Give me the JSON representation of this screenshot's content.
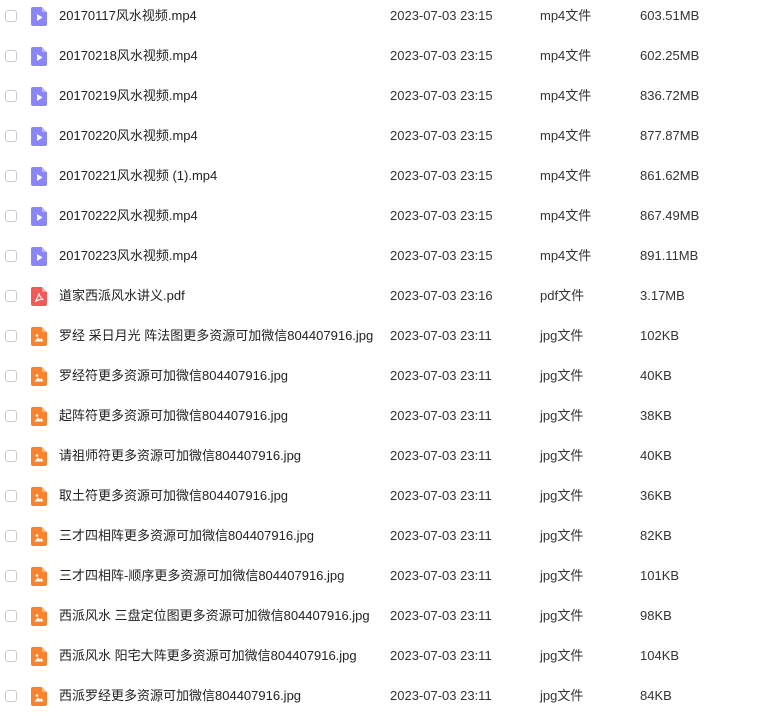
{
  "colors": {
    "video_icon": "#8b86f5",
    "pdf_icon": "#f25a5a",
    "image_icon": "#f7832f",
    "checkbox_border": "#c8c8c8",
    "text": "#222222"
  },
  "icons": {
    "video": "video-file-icon",
    "pdf": "pdf-file-icon",
    "image": "image-file-icon"
  },
  "files": [
    {
      "name": "20170117风水视频.mp4",
      "date": "2023-07-03 23:15",
      "type": "mp4文件",
      "size": "603.51MB",
      "kind": "video"
    },
    {
      "name": "20170218风水视频.mp4",
      "date": "2023-07-03 23:15",
      "type": "mp4文件",
      "size": "602.25MB",
      "kind": "video"
    },
    {
      "name": "20170219风水视频.mp4",
      "date": "2023-07-03 23:15",
      "type": "mp4文件",
      "size": "836.72MB",
      "kind": "video"
    },
    {
      "name": "20170220风水视频.mp4",
      "date": "2023-07-03 23:15",
      "type": "mp4文件",
      "size": "877.87MB",
      "kind": "video"
    },
    {
      "name": "20170221风水视频 (1).mp4",
      "date": "2023-07-03 23:15",
      "type": "mp4文件",
      "size": "861.62MB",
      "kind": "video"
    },
    {
      "name": "20170222风水视频.mp4",
      "date": "2023-07-03 23:15",
      "type": "mp4文件",
      "size": "867.49MB",
      "kind": "video"
    },
    {
      "name": "20170223风水视频.mp4",
      "date": "2023-07-03 23:15",
      "type": "mp4文件",
      "size": "891.11MB",
      "kind": "video"
    },
    {
      "name": "道家西派风水讲义.pdf",
      "date": "2023-07-03 23:16",
      "type": "pdf文件",
      "size": "3.17MB",
      "kind": "pdf"
    },
    {
      "name": "罗经 采日月光 阵法图更多资源可加微信804407916.jpg",
      "date": "2023-07-03 23:11",
      "type": "jpg文件",
      "size": "102KB",
      "kind": "image"
    },
    {
      "name": "罗经符更多资源可加微信804407916.jpg",
      "date": "2023-07-03 23:11",
      "type": "jpg文件",
      "size": "40KB",
      "kind": "image"
    },
    {
      "name": "起阵符更多资源可加微信804407916.jpg",
      "date": "2023-07-03 23:11",
      "type": "jpg文件",
      "size": "38KB",
      "kind": "image"
    },
    {
      "name": "请祖师符更多资源可加微信804407916.jpg",
      "date": "2023-07-03 23:11",
      "type": "jpg文件",
      "size": "40KB",
      "kind": "image"
    },
    {
      "name": "取土符更多资源可加微信804407916.jpg",
      "date": "2023-07-03 23:11",
      "type": "jpg文件",
      "size": "36KB",
      "kind": "image"
    },
    {
      "name": "三才四相阵更多资源可加微信804407916.jpg",
      "date": "2023-07-03 23:11",
      "type": "jpg文件",
      "size": "82KB",
      "kind": "image"
    },
    {
      "name": "三才四相阵-顺序更多资源可加微信804407916.jpg",
      "date": "2023-07-03 23:11",
      "type": "jpg文件",
      "size": "101KB",
      "kind": "image"
    },
    {
      "name": "西派风水 三盘定位图更多资源可加微信804407916.jpg",
      "date": "2023-07-03 23:11",
      "type": "jpg文件",
      "size": "98KB",
      "kind": "image"
    },
    {
      "name": "西派风水 阳宅大阵更多资源可加微信804407916.jpg",
      "date": "2023-07-03 23:11",
      "type": "jpg文件",
      "size": "104KB",
      "kind": "image"
    },
    {
      "name": "西派罗经更多资源可加微信804407916.jpg",
      "date": "2023-07-03 23:11",
      "type": "jpg文件",
      "size": "84KB",
      "kind": "image"
    }
  ]
}
